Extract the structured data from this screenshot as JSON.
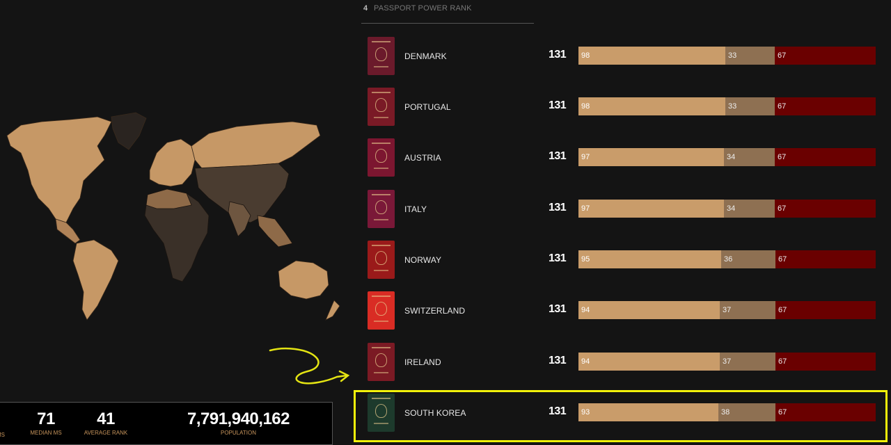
{
  "colors": {
    "visa_free": "#c99c6a",
    "visa_on_arrival": "#8e7052",
    "visa_required": "#6a0000",
    "accent_label": "#c8955c",
    "highlight": "#f2f20a"
  },
  "rank_header": {
    "rank": "4",
    "label": "PASSPORT POWER RANK"
  },
  "countries": [
    {
      "name": "DENMARK",
      "total": "131",
      "free": "98",
      "voa": "33",
      "req": "67",
      "passport_color": "#6b1a2b"
    },
    {
      "name": "PORTUGAL",
      "total": "131",
      "free": "98",
      "voa": "33",
      "req": "67",
      "passport_color": "#7a1a26"
    },
    {
      "name": "AUSTRIA",
      "total": "131",
      "free": "97",
      "voa": "34",
      "req": "67",
      "passport_color": "#7c1630"
    },
    {
      "name": "ITALY",
      "total": "131",
      "free": "97",
      "voa": "34",
      "req": "67",
      "passport_color": "#7a1838"
    },
    {
      "name": "NORWAY",
      "total": "131",
      "free": "95",
      "voa": "36",
      "req": "67",
      "passport_color": "#9a1a1a"
    },
    {
      "name": "SWITZERLAND",
      "total": "131",
      "free": "94",
      "voa": "37",
      "req": "67",
      "passport_color": "#d92c24"
    },
    {
      "name": "IRELAND",
      "total": "131",
      "free": "94",
      "voa": "37",
      "req": "67",
      "passport_color": "#7b1a24"
    },
    {
      "name": "SOUTH KOREA",
      "total": "131",
      "free": "93",
      "voa": "38",
      "req": "67",
      "passport_color": "#1d3a2c"
    }
  ],
  "stats": {
    "cut_label": "MS",
    "median": {
      "value": "71",
      "label": "MEDIAN MS"
    },
    "average": {
      "value": "41",
      "label": "AVERAGE RANK"
    },
    "population": {
      "value": "7,791,940,162",
      "label": "POPULATION"
    }
  },
  "annotation": {
    "highlighted_country": "SOUTH KOREA"
  }
}
